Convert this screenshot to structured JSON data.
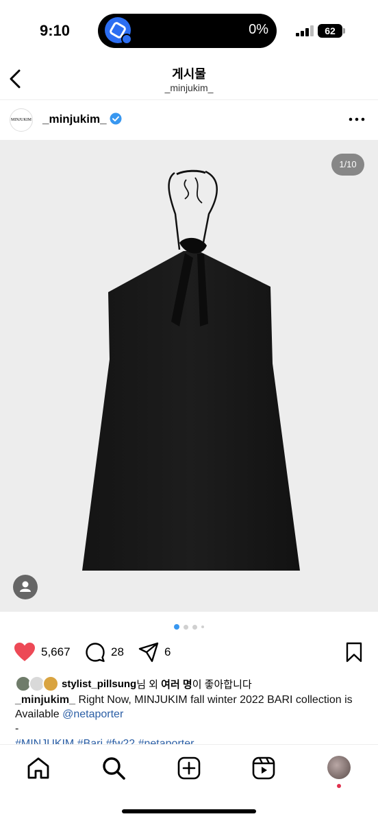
{
  "status_bar": {
    "time": "9:10",
    "island_text": "0%",
    "battery": "62"
  },
  "header": {
    "title": "게시물",
    "subtitle": "_minjukim_"
  },
  "post": {
    "avatar_text": "MINJUKIM",
    "username": "_minjukim_",
    "image_counter": "1/10",
    "likes_count": "5,667",
    "comments_count": "28",
    "shares_count": "6",
    "liked_by_user": "stylist_pillsung",
    "liked_by_mid": "님 외 ",
    "liked_by_others": "여러 명",
    "liked_by_tail": "이 좋아합니다",
    "caption_user": "_minjukim_",
    "caption_text": " Right Now, MINJUKIM fall winter 2022 BARI collection is Available ",
    "caption_mention": "@netaporter",
    "caption_dash": "-",
    "hashtags": "#MINJUKIM #Bari #fw22 #netaporter"
  },
  "colors": {
    "like_red": "#ed4956",
    "link_blue": "#2a5ea5",
    "verified_blue": "#3897f0"
  },
  "icons": [
    "back-icon",
    "verified-icon",
    "more-icon",
    "heart-icon",
    "comment-icon",
    "share-icon",
    "bookmark-icon",
    "home-icon",
    "search-icon",
    "create-icon",
    "reels-icon"
  ]
}
